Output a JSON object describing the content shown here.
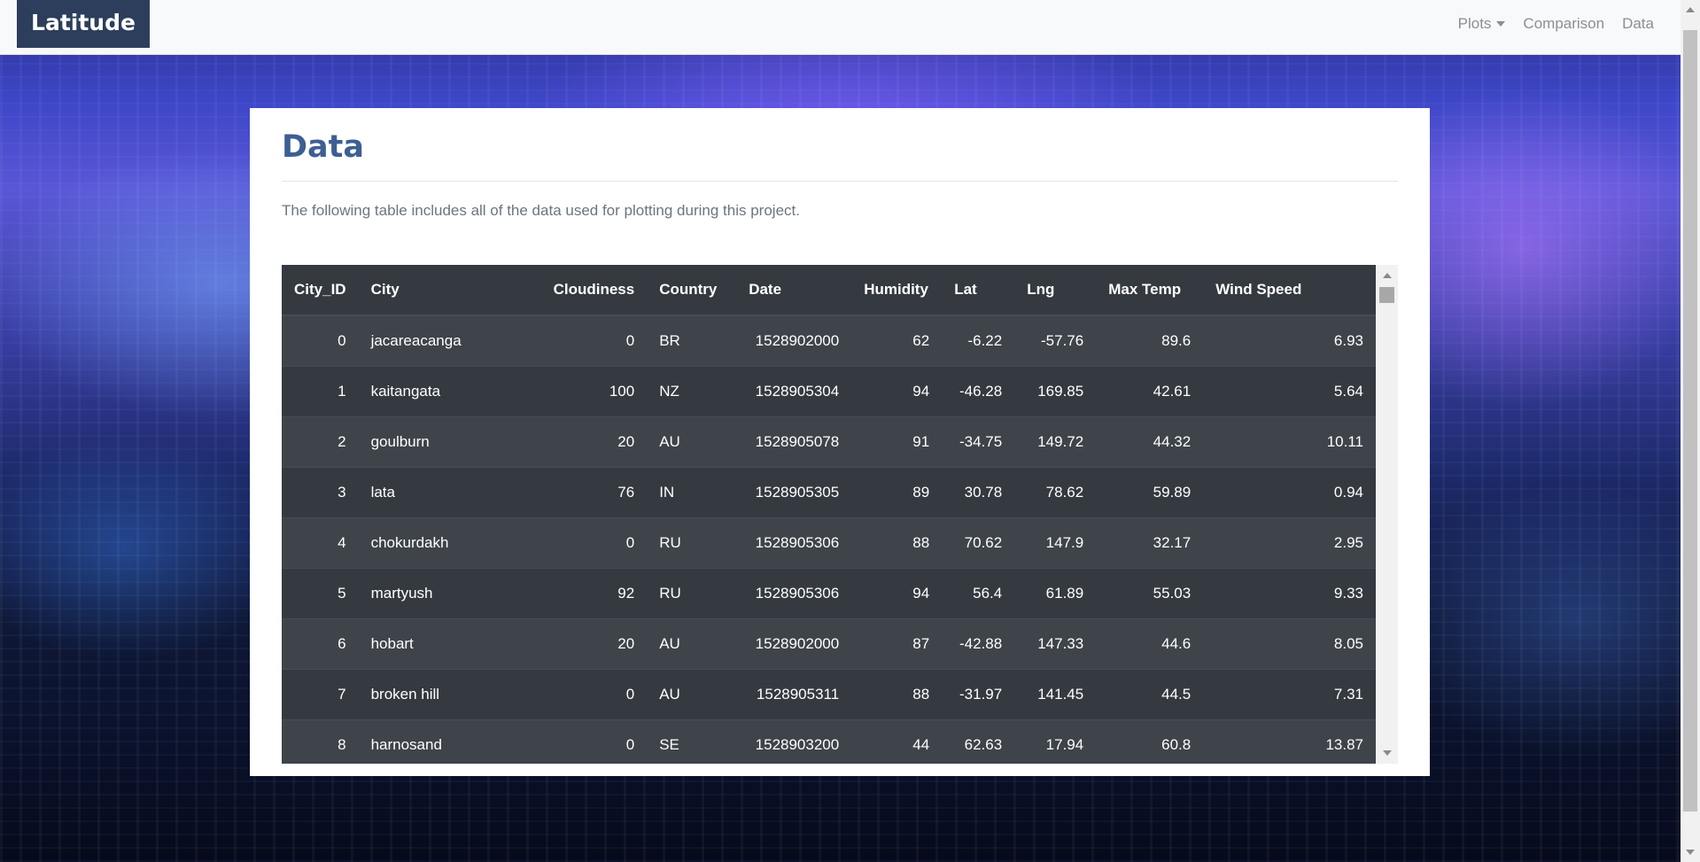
{
  "navbar": {
    "brand": "Latitude",
    "links": [
      {
        "label": "Plots",
        "dropdown": true
      },
      {
        "label": "Comparison"
      },
      {
        "label": "Data"
      }
    ]
  },
  "main": {
    "title": "Data",
    "description": "The following table includes all of the data used for plotting during this project."
  },
  "table": {
    "headers": [
      "City_ID",
      "City",
      "Cloudiness",
      "Country",
      "Date",
      "Humidity",
      "Lat",
      "Lng",
      "Max Temp",
      "Wind Speed"
    ],
    "rows": [
      [
        "0",
        "jacareacanga",
        "0",
        "BR",
        "1528902000",
        "62",
        "-6.22",
        "-57.76",
        "89.6",
        "6.93"
      ],
      [
        "1",
        "kaitangata",
        "100",
        "NZ",
        "1528905304",
        "94",
        "-46.28",
        "169.85",
        "42.61",
        "5.64"
      ],
      [
        "2",
        "goulburn",
        "20",
        "AU",
        "1528905078",
        "91",
        "-34.75",
        "149.72",
        "44.32",
        "10.11"
      ],
      [
        "3",
        "lata",
        "76",
        "IN",
        "1528905305",
        "89",
        "30.78",
        "78.62",
        "59.89",
        "0.94"
      ],
      [
        "4",
        "chokurdakh",
        "0",
        "RU",
        "1528905306",
        "88",
        "70.62",
        "147.9",
        "32.17",
        "2.95"
      ],
      [
        "5",
        "martyush",
        "92",
        "RU",
        "1528905306",
        "94",
        "56.4",
        "61.89",
        "55.03",
        "9.33"
      ],
      [
        "6",
        "hobart",
        "20",
        "AU",
        "1528902000",
        "87",
        "-42.88",
        "147.33",
        "44.6",
        "8.05"
      ],
      [
        "7",
        "broken hill",
        "0",
        "AU",
        "1528905311",
        "88",
        "-31.97",
        "141.45",
        "44.5",
        "7.31"
      ],
      [
        "8",
        "harnosand",
        "0",
        "SE",
        "1528903200",
        "44",
        "62.63",
        "17.94",
        "60.8",
        "13.87"
      ]
    ]
  },
  "colors": {
    "brand_bg": "#2c3e5c",
    "title": "#3e5f93",
    "table_bg": "#343a40",
    "table_stripe": "#3e444a"
  }
}
